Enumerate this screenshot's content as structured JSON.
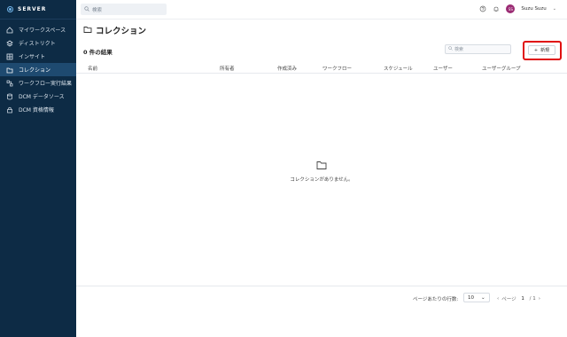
{
  "brand": {
    "name": "SERVER"
  },
  "sidebar": {
    "items": [
      {
        "label": "マイワークスペース",
        "icon": "home-icon"
      },
      {
        "label": "ディストリクト",
        "icon": "layers-icon"
      },
      {
        "label": "インサイト",
        "icon": "grid-icon"
      },
      {
        "label": "コレクション",
        "icon": "folder-icon",
        "active": true
      },
      {
        "label": "ワークフロー実行結果",
        "icon": "workflow-icon"
      },
      {
        "label": "DCM データソース",
        "icon": "database-icon"
      },
      {
        "label": "DCM 資格情報",
        "icon": "lock-icon"
      }
    ]
  },
  "topbar": {
    "search_placeholder": "検索",
    "user_initials": "SS",
    "user_name": "Suzu Suzu"
  },
  "main": {
    "title": "コレクション",
    "results": "0 件の結果",
    "search_placeholder": "検索",
    "new_button": "新規",
    "columns": [
      "名前",
      "所有者",
      "作成済み",
      "ワークフロー",
      "スケジュール",
      "ユーザー",
      "ユーザーグループ"
    ],
    "empty_message": "コレクションがありません。"
  },
  "pagination": {
    "rows_label": "ページあたりの行数:",
    "rows_value": "10",
    "page_label": "ページ",
    "current_page": "1",
    "total_pages": "/ 1"
  },
  "colors": {
    "sidebar_bg": "#0d2b45",
    "active_bg": "#1e4a70",
    "highlight": "#e01010",
    "avatar": "#9b2c74"
  }
}
